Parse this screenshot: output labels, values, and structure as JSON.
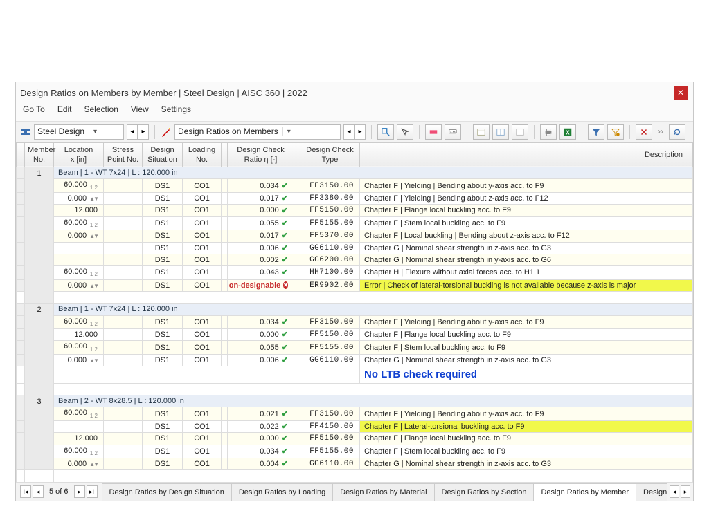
{
  "title": "Design Ratios on Members by Member | Steel Design | AISC 360 | 2022",
  "menu": [
    "Go To",
    "Edit",
    "Selection",
    "View",
    "Settings"
  ],
  "combo1": "Steel Design",
  "combo2": "Design Ratios on Members",
  "headers": {
    "memberNo": "Member\nNo.",
    "location": "Location\nx [in]",
    "stressPoint": "Stress\nPoint No.",
    "designSit": "Design\nSituation",
    "loading": "Loading\nNo.",
    "ratio": "Design Check\nRatio η [-]",
    "type": "Design Check\nType",
    "description": "Description"
  },
  "groups": [
    {
      "memberNo": "1",
      "label": "Beam | 1 - WT 7x24 | L : 120.000 in",
      "rows": [
        {
          "loc": "60.000",
          "locMark": "sub12",
          "ds": "DS1",
          "ld": "CO1",
          "ratio": "0.034",
          "ok": true,
          "code": "FF3150.00",
          "desc": "Chapter F | Yielding | Bending about y-axis acc. to F9"
        },
        {
          "loc": "0.000",
          "locMark": "arrows",
          "ds": "DS1",
          "ld": "CO1",
          "ratio": "0.017",
          "ok": true,
          "code": "FF3380.00",
          "desc": "Chapter F | Yielding | Bending about z-axis acc. to F12"
        },
        {
          "loc": "12.000",
          "ds": "DS1",
          "ld": "CO1",
          "ratio": "0.000",
          "ok": true,
          "code": "FF5150.00",
          "desc": "Chapter F | Flange local buckling acc. to F9"
        },
        {
          "loc": "60.000",
          "locMark": "sub12",
          "ds": "DS1",
          "ld": "CO1",
          "ratio": "0.055",
          "ok": true,
          "code": "FF5155.00",
          "desc": "Chapter F | Stem local buckling acc. to F9"
        },
        {
          "loc": "0.000",
          "locMark": "arrows",
          "ds": "DS1",
          "ld": "CO1",
          "ratio": "0.017",
          "ok": true,
          "code": "FF5370.00",
          "desc": "Chapter F | Local buckling | Bending about z-axis acc. to F12"
        },
        {
          "ds": "DS1",
          "ld": "CO1",
          "ratio": "0.006",
          "ok": true,
          "code": "GG6110.00",
          "desc": "Chapter G | Nominal shear strength in z-axis acc. to G3"
        },
        {
          "ds": "DS1",
          "ld": "CO1",
          "ratio": "0.002",
          "ok": true,
          "code": "GG6200.00",
          "desc": "Chapter G | Nominal shear strength in y-axis acc. to G6"
        },
        {
          "loc": "60.000",
          "locMark": "sub12",
          "ds": "DS1",
          "ld": "CO1",
          "ratio": "0.043",
          "ok": true,
          "code": "HH7100.00",
          "desc": "Chapter H | Flexure without axial forces acc. to H1.1"
        },
        {
          "loc": "0.000",
          "locMark": "arrows",
          "ds": "DS1",
          "ld": "CO1",
          "ratio": "Non-designable",
          "ok": false,
          "code": "ER9902.00",
          "desc": "Error | Check of lateral-torsional buckling is not available because z-axis is major",
          "hi": true
        }
      ]
    },
    {
      "memberNo": "2",
      "label": "Beam | 1 - WT 7x24 | L : 120.000 in",
      "rows": [
        {
          "loc": "60.000",
          "locMark": "sub12",
          "ds": "DS1",
          "ld": "CO1",
          "ratio": "0.034",
          "ok": true,
          "code": "FF3150.00",
          "desc": "Chapter F | Yielding | Bending about y-axis acc. to F9"
        },
        {
          "loc": "12.000",
          "ds": "DS1",
          "ld": "CO1",
          "ratio": "0.000",
          "ok": true,
          "code": "FF5150.00",
          "desc": "Chapter F | Flange local buckling acc. to F9"
        },
        {
          "loc": "60.000",
          "locMark": "sub12",
          "ds": "DS1",
          "ld": "CO1",
          "ratio": "0.055",
          "ok": true,
          "code": "FF5155.00",
          "desc": "Chapter F | Stem local buckling acc. to F9"
        },
        {
          "loc": "0.000",
          "locMark": "arrows",
          "ds": "DS1",
          "ld": "CO1",
          "ratio": "0.006",
          "ok": true,
          "code": "GG6110.00",
          "desc": "Chapter G | Nominal shear strength in z-axis acc. to G3"
        }
      ],
      "annotation": "No LTB check required"
    },
    {
      "memberNo": "3",
      "label": "Beam | 2 - WT 8x28.5 | L : 120.000 in",
      "rows": [
        {
          "loc": "60.000",
          "locMark": "sub12",
          "ds": "DS1",
          "ld": "CO1",
          "ratio": "0.021",
          "ok": true,
          "code": "FF3150.00",
          "desc": "Chapter F | Yielding | Bending about y-axis acc. to F9"
        },
        {
          "ds": "DS1",
          "ld": "CO1",
          "ratio": "0.022",
          "ok": true,
          "code": "FF4150.00",
          "desc": "Chapter F | Lateral-torsional buckling acc. to F9",
          "hi": true
        },
        {
          "loc": "12.000",
          "ds": "DS1",
          "ld": "CO1",
          "ratio": "0.000",
          "ok": true,
          "code": "FF5150.00",
          "desc": "Chapter F | Flange local buckling acc. to F9"
        },
        {
          "loc": "60.000",
          "locMark": "sub12",
          "ds": "DS1",
          "ld": "CO1",
          "ratio": "0.034",
          "ok": true,
          "code": "FF5155.00",
          "desc": "Chapter F | Stem local buckling acc. to F9"
        },
        {
          "loc": "0.000",
          "locMark": "arrows",
          "ds": "DS1",
          "ld": "CO1",
          "ratio": "0.004",
          "ok": true,
          "code": "GG6110.00",
          "desc": "Chapter G | Nominal shear strength in z-axis acc. to G3"
        }
      ]
    }
  ],
  "pager": "5 of 6",
  "tabs": [
    "Design Ratios by Design Situation",
    "Design Ratios by Loading",
    "Design Ratios by Material",
    "Design Ratios by Section",
    "Design Ratios by Member",
    "Design"
  ],
  "activeTab": 4,
  "evenBg": "#fffef0"
}
